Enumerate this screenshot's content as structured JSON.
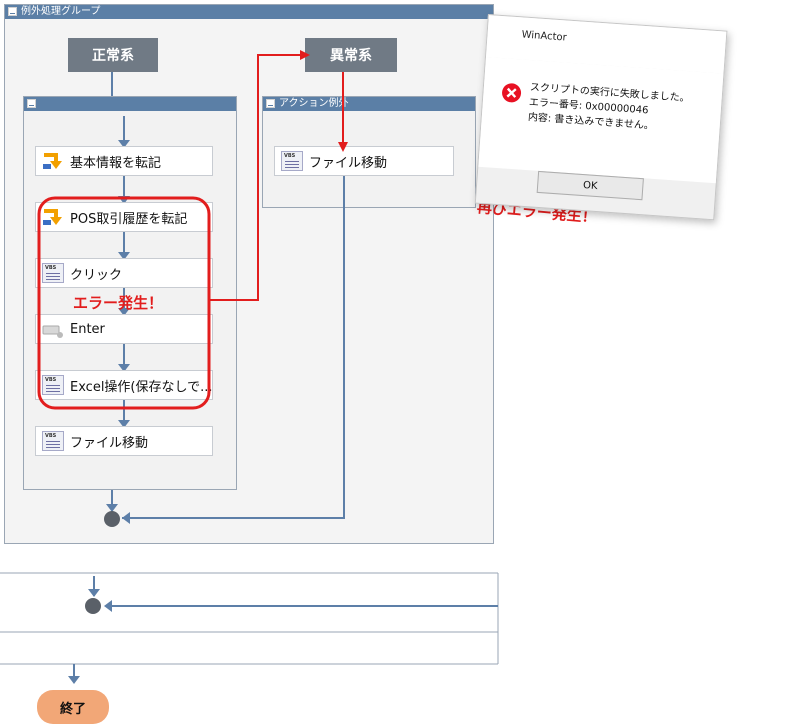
{
  "flow": {
    "outer_group_title": "例外処理グループ",
    "normal_label": "正常系",
    "abnormal_label": "異常系",
    "inner_group_title": "",
    "action_group_title": "アクション例外",
    "normal_nodes": [
      {
        "label": "基本情報を転記",
        "icon": "transfer-icon"
      },
      {
        "label": "POS取引履歴を転記",
        "icon": "transfer-icon"
      },
      {
        "label": "クリック",
        "icon": "vbs-script-icon"
      },
      {
        "label": "Enter",
        "icon": "keyboard-icon"
      },
      {
        "label": "Excel操作(保存なしで...",
        "icon": "vbs-script-icon"
      },
      {
        "label": "ファイル移動",
        "icon": "vbs-script-icon"
      }
    ],
    "exception_node": {
      "label": "ファイル移動",
      "icon": "vbs-script-icon"
    },
    "end_label": "終了",
    "vbs_tag": "VBS"
  },
  "annotations": {
    "error_occurred": "エラー発生！",
    "error_again": "再びエラー発生！",
    "highlight_color": "#e21d1d"
  },
  "dialog": {
    "title": "WinActor",
    "close": "×",
    "message_lines": [
      "スクリプトの実行に失敗しました。",
      "エラー番号: 0x00000046",
      "内容: 書き込みできません。"
    ],
    "ok_label": "OK"
  },
  "colors": {
    "group_header": "#5b7fa6",
    "connector": "#5d7fa8",
    "phase_box": "#707a85",
    "end_node": "#f2a777"
  }
}
